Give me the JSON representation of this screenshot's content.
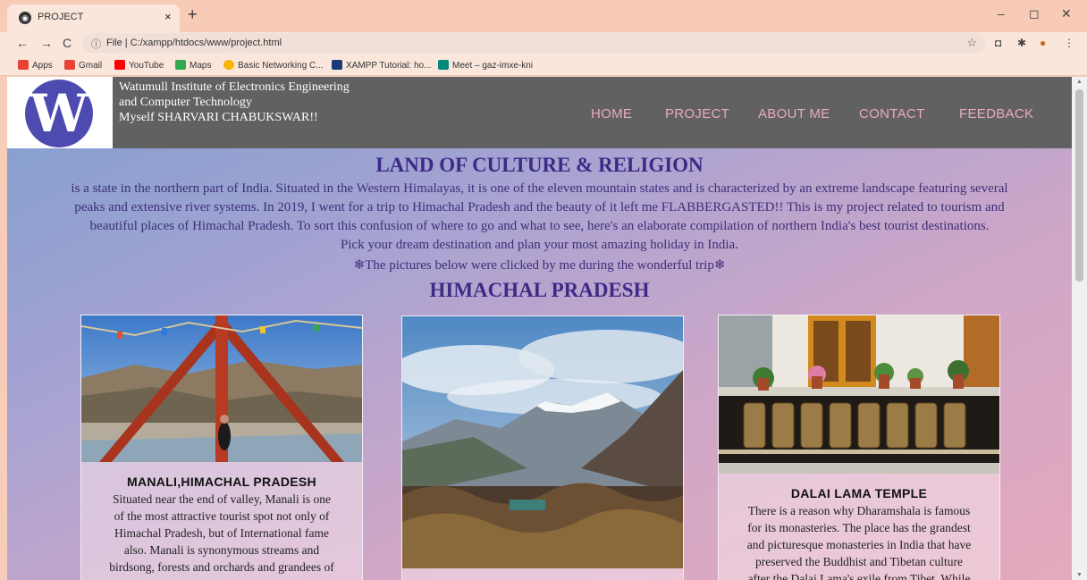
{
  "browser": {
    "tab_title": "PROJECT",
    "tab_close": "×",
    "new_tab": "+",
    "window_controls": [
      "–",
      "◻",
      "✕"
    ],
    "nav_icons": [
      "←",
      "→",
      "C"
    ],
    "address_prefix": "File",
    "address": "C:/xampp/htdocs/www/project.html",
    "bookmarks": [
      {
        "label": "Apps",
        "icon_color": "#e94235"
      },
      {
        "label": "Gmail",
        "icon_color": "#ea4335"
      },
      {
        "label": "YouTube",
        "icon_color": "#ff0000"
      },
      {
        "label": "Maps",
        "icon_color": "#34a853"
      },
      {
        "label": "Basic Networking C...",
        "icon_color": "#f5b400"
      },
      {
        "label": "XAMPP Tutorial: ho...",
        "icon_color": "#1a3a7a"
      },
      {
        "label": "Meet – gaz-imxe-kni",
        "icon_color": "#00897b"
      }
    ]
  },
  "site": {
    "logo_letter": "W",
    "org_line1": "Watumull Institute of Electronics Engineering",
    "org_line2": "and Computer Technology",
    "org_line3": "Myself SHARVARI CHABUKSWAR!!",
    "nav": [
      "HOME",
      "PROJECT",
      "ABOUT ME",
      "CONTACT",
      "FEEDBACK"
    ]
  },
  "content": {
    "title": "LAND OF CULTURE & RELIGION",
    "intro_lines": [
      "is a state in the northern part of India. Situated in the Western Himalayas, it is one of the eleven mountain states and is characterized by an extreme landscape featuring several",
      "peaks and extensive river systems. In 2019, I went for a trip to Himachal Pradesh and the beauty of it left me FLABBERGASTED!! This is my project related to tourism and",
      "beautiful places of Himachal Pradesh. To sort this confusion of where to go and what to see, here's an elaborate compilation of northern India's best tourist destinations.",
      "Pick your dream destination and plan your most amazing holiday in India."
    ],
    "note": "❄The pictures below were clicked by me during the wonderful trip❄",
    "section_title": "HIMACHAL PRADESH"
  },
  "cards": [
    {
      "title": "MANALI,HIMACHAL PRADESH",
      "text_lines": [
        "Situated near the end of valley, Manali is one",
        "of the most attractive tourist spot not only of",
        "Himachal Pradesh, but of International fame",
        "also. Manali is synonymous streams and",
        "birdsong, forests and orchards and grandees of"
      ]
    },
    {
      "title": "",
      "text_lines": []
    },
    {
      "title": "DALAI LAMA TEMPLE",
      "text_lines": [
        "There is a reason why Dharamshala is famous",
        "for its monasteries. The place has the grandest",
        "and picturesque monasteries in India that have",
        "preserved the Buddhist and Tibetan culture",
        "after the Dalai Lama's exile from Tibet. While"
      ]
    }
  ]
}
